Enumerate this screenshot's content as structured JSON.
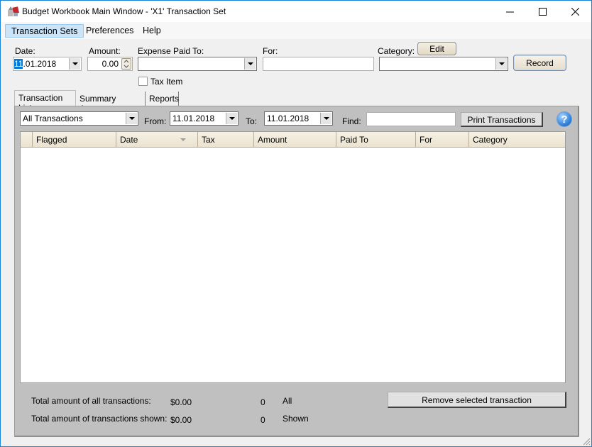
{
  "window": {
    "title": "Budget Workbook Main Window - 'X1' Transaction Set",
    "controls": {
      "minimize": "minimize-icon",
      "maximize": "maximize-icon",
      "close": "close-icon"
    }
  },
  "menu": {
    "items": [
      {
        "label": "Transaction Sets",
        "active": true
      },
      {
        "label": "Preferences",
        "active": false
      },
      {
        "label": "Help",
        "active": false
      }
    ]
  },
  "entry_form": {
    "date_label": "Date:",
    "date_value_selected": "11",
    "date_value_rest": ".01.2018",
    "amount_label": "Amount:",
    "amount_value": "0.00",
    "paid_to_label": "Expense Paid To:",
    "paid_to_value": "",
    "for_label": "For:",
    "for_value": "",
    "category_label": "Category:",
    "category_value": "",
    "edit_button": "Edit",
    "record_button": "Record",
    "tax_item_label": "Tax Item",
    "tax_item_checked": false
  },
  "tabs": [
    {
      "label": "Transaction List",
      "active": true
    },
    {
      "label": "Summary Amounts",
      "active": false
    },
    {
      "label": "Reports",
      "active": false
    }
  ],
  "filter_bar": {
    "filter_value": "All Transactions",
    "from_label": "From:",
    "from_value": "11.01.2018",
    "to_label": "To:",
    "to_value": "11.01.2018",
    "find_label": "Find:",
    "find_value": "",
    "print_button": "Print Transactions",
    "help_glyph": "?"
  },
  "grid": {
    "columns": [
      "Flagged",
      "Date",
      "Tax",
      "Amount",
      "Paid To",
      "For",
      "Category"
    ],
    "sorted_column": "Date",
    "rows": []
  },
  "footer": {
    "total_all_label": "Total amount of all transactions:",
    "total_all_amount": "$0.00",
    "total_all_count": "0",
    "total_all_suffix": "All",
    "total_shown_label": "Total amount of transactions shown:",
    "total_shown_amount": "$0.00",
    "total_shown_count": "0",
    "total_shown_suffix": "Shown",
    "remove_button": "Remove selected transaction"
  }
}
